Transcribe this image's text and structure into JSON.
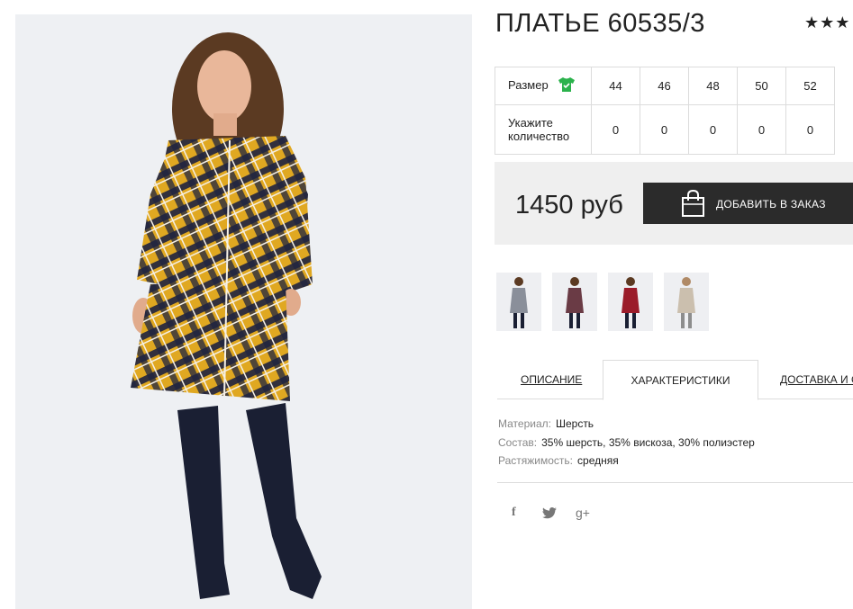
{
  "product": {
    "title": "ПЛАТЬЕ 60535/3",
    "rating_stars": "★★★",
    "price": "1450 руб",
    "add_button_label": "ДОБАВИТЬ В ЗАКАЗ"
  },
  "sizes": {
    "size_label": "Размер",
    "qty_label_line1": "Укажите",
    "qty_label_line2": "количество",
    "values": [
      "44",
      "46",
      "48",
      "50",
      "52"
    ],
    "quantities": [
      "0",
      "0",
      "0",
      "0",
      "0"
    ]
  },
  "thumbnails": [
    {
      "name": "thumb-gray-plaid",
      "color": "#8a8f9a"
    },
    {
      "name": "thumb-dark-plaid",
      "color": "#6a3b45"
    },
    {
      "name": "thumb-red",
      "color": "#9b1c2a"
    },
    {
      "name": "thumb-beige",
      "color": "#cbbfae"
    }
  ],
  "tabs": {
    "description": "ОПИСАНИЕ",
    "characteristics": "ХАРАКТЕРИСТИКИ",
    "delivery": "ДОСТАВКА И ОПЛАТА"
  },
  "specs": [
    {
      "key": "Материал:",
      "value": "Шерсть"
    },
    {
      "key": "Состав:",
      "value": "35% шерсть, 35% вискоза, 30% полиэстер"
    },
    {
      "key": "Растяжимость:",
      "value": "средняя"
    }
  ],
  "social": {
    "facebook": "f",
    "twitter": "twitter-icon",
    "googleplus": "g+"
  },
  "colors": {
    "accent_green": "#2bb24c",
    "button_dark": "#2b2b2b",
    "buybox_bg": "#efefef",
    "plaid_yellow": "#e0a821",
    "plaid_navy": "#1f2440"
  }
}
